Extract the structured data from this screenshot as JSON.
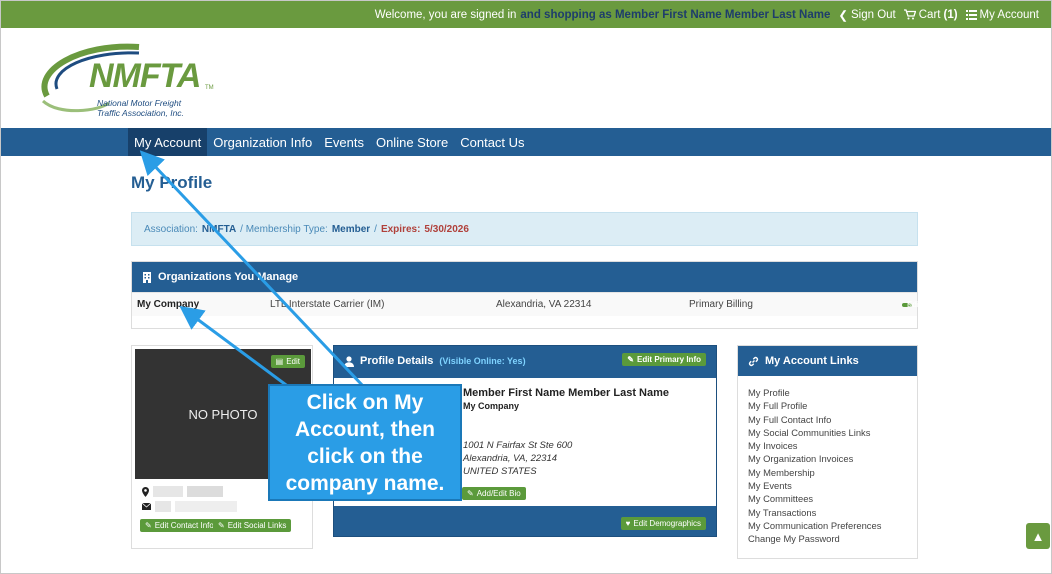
{
  "topbar": {
    "welcome": "Welcome, you are signed in",
    "shopping": "and shopping as Member First Name Member Last Name",
    "sign_out": "Sign Out",
    "cart": "Cart",
    "cart_count": "(1)",
    "my_account": "My Account"
  },
  "logo": {
    "brand": "NMFTA",
    "tm": "TM",
    "tagline_1": "National Motor Freight",
    "tagline_2": "Traffic Association, Inc."
  },
  "nav": {
    "items": [
      "My Account",
      "Organization Info",
      "Events",
      "Online Store",
      "Contact Us"
    ]
  },
  "page_title": "My Profile",
  "membership": {
    "assoc_label": "Association:",
    "assoc_value": "NMFTA",
    "type_label": "/ Membership Type:",
    "type_value": "Member",
    "sep": "/",
    "expires_label": "Expires:",
    "expires_value": "5/30/2026"
  },
  "orgs": {
    "title": "Organizations You Manage",
    "row": {
      "company": "My Company",
      "carrier": "LTL Interstate Carrier (IM)",
      "location": "Alexandria, VA 22314",
      "billing": "Primary Billing",
      "edit": "Edit"
    }
  },
  "photo": {
    "no_photo": "NO PHOTO",
    "edit": "Edit",
    "edit_contact": "Edit Contact Info",
    "edit_social": "Edit Social Links"
  },
  "details": {
    "title": "Profile Details",
    "visible_open": "(",
    "visible": "Visible Online: Yes",
    "visible_close": ")",
    "edit_primary": "Edit Primary Info",
    "name": "Member First Name Member Last Name",
    "company": "My Company",
    "addr1": "1001 N Fairfax St Ste 600",
    "addr2": "Alexandria, VA, 22314",
    "addr3": "UNITED STATES",
    "add_bio": "Add/Edit Bio",
    "edit_demo": "Edit Demographics"
  },
  "links": {
    "title": "My Account Links",
    "items": [
      "My Profile",
      "My Full Profile",
      "My Full Contact Info",
      "My Social Communities Links",
      "My Invoices",
      "My Organization Invoices",
      "My Membership",
      "My Events",
      "My Committees",
      "My Transactions",
      "My Communication Preferences",
      "Change My Password"
    ]
  },
  "callout": {
    "text": "Click on My Account, then click on the company name."
  },
  "colors": {
    "green": "#6a9a3f",
    "blue": "#245e93",
    "callout": "#2a9de6"
  }
}
